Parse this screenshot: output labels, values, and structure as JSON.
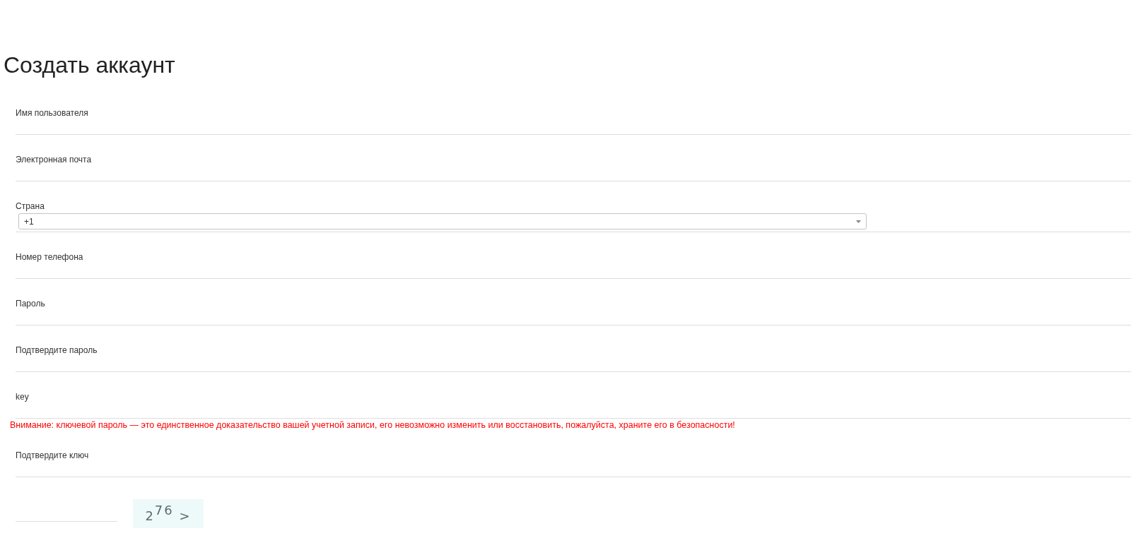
{
  "title": "Создать аккаунт",
  "fields": [
    {
      "kind": "text",
      "label": "Имя пользователя"
    },
    {
      "kind": "text",
      "label": "Электронная почта"
    },
    {
      "kind": "select",
      "label": "Страна",
      "value": "+1"
    },
    {
      "kind": "text",
      "label": "Номер телефона"
    },
    {
      "kind": "text",
      "label": "Пароль"
    },
    {
      "kind": "text",
      "label": "Подтвердите пароль"
    },
    {
      "kind": "text",
      "label": "key",
      "warning": "Внимание: ключевой пароль — это единственное доказательство вашей учетной записи, его невозможно изменить или восстановить, пожалуйста, храните его в безопасности!"
    },
    {
      "kind": "text",
      "label": "Подтвердите ключ"
    }
  ],
  "captcha": {
    "code": "2$^{76}$ >"
  }
}
